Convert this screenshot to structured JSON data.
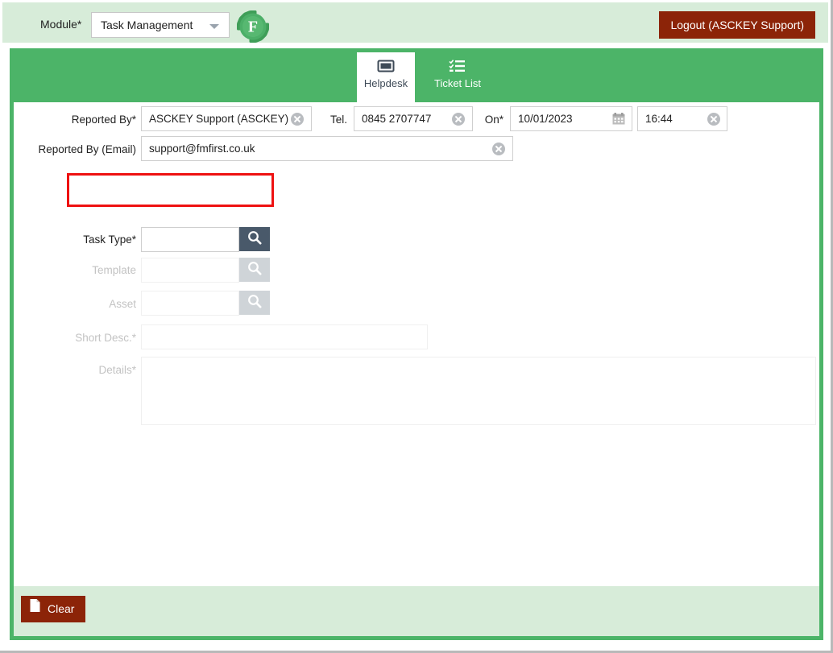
{
  "topbar": {
    "module_label": "Module*",
    "module_value": "Task Management",
    "module_caret_icon": "chevron-down-icon",
    "logo_icon": "fm-first-gear-logo",
    "logout_label": "Logout (ASCKEY Support)"
  },
  "tabs": [
    {
      "label": "Helpdesk",
      "icon": "ticket-card-icon",
      "active": true
    },
    {
      "label": "Ticket List",
      "icon": "list-checklist-icon",
      "active": false
    }
  ],
  "form": {
    "reported_by": {
      "label": "Reported By*",
      "value": "ASCKEY Support (ASCKEY)",
      "clear_icon": "clear-circle-icon"
    },
    "tel": {
      "label": "Tel.",
      "value": "0845 2707747",
      "clear_icon": "clear-circle-icon"
    },
    "on": {
      "label": "On*",
      "date_value": "10/01/2023",
      "calendar_icon": "calendar-icon",
      "time_value": "16:44",
      "clear_icon": "clear-circle-icon"
    },
    "reported_by_email": {
      "label": "Reported By (Email)",
      "value": "support@fmfirst.co.uk",
      "clear_icon": "clear-circle-icon"
    },
    "task_type": {
      "label": "Task Type*",
      "value": "",
      "search_icon": "search-icon",
      "highlighted": true
    },
    "template": {
      "label": "Template",
      "value": "",
      "search_icon": "search-icon",
      "disabled": true
    },
    "asset": {
      "label": "Asset",
      "value": "",
      "search_icon": "search-icon",
      "disabled": true
    },
    "short_desc": {
      "label": "Short Desc.*",
      "value": "",
      "disabled": true
    },
    "details": {
      "label": "Details*",
      "value": "",
      "disabled": true
    }
  },
  "actions": {
    "clear_label": "Clear",
    "clear_icon": "page-document-icon"
  },
  "colors": {
    "brand_green": "#4cb468",
    "pale_green": "#d7ecd9",
    "dark_red": "#8c2408",
    "highlight_red": "#ee1111",
    "slate": "#49596a"
  }
}
